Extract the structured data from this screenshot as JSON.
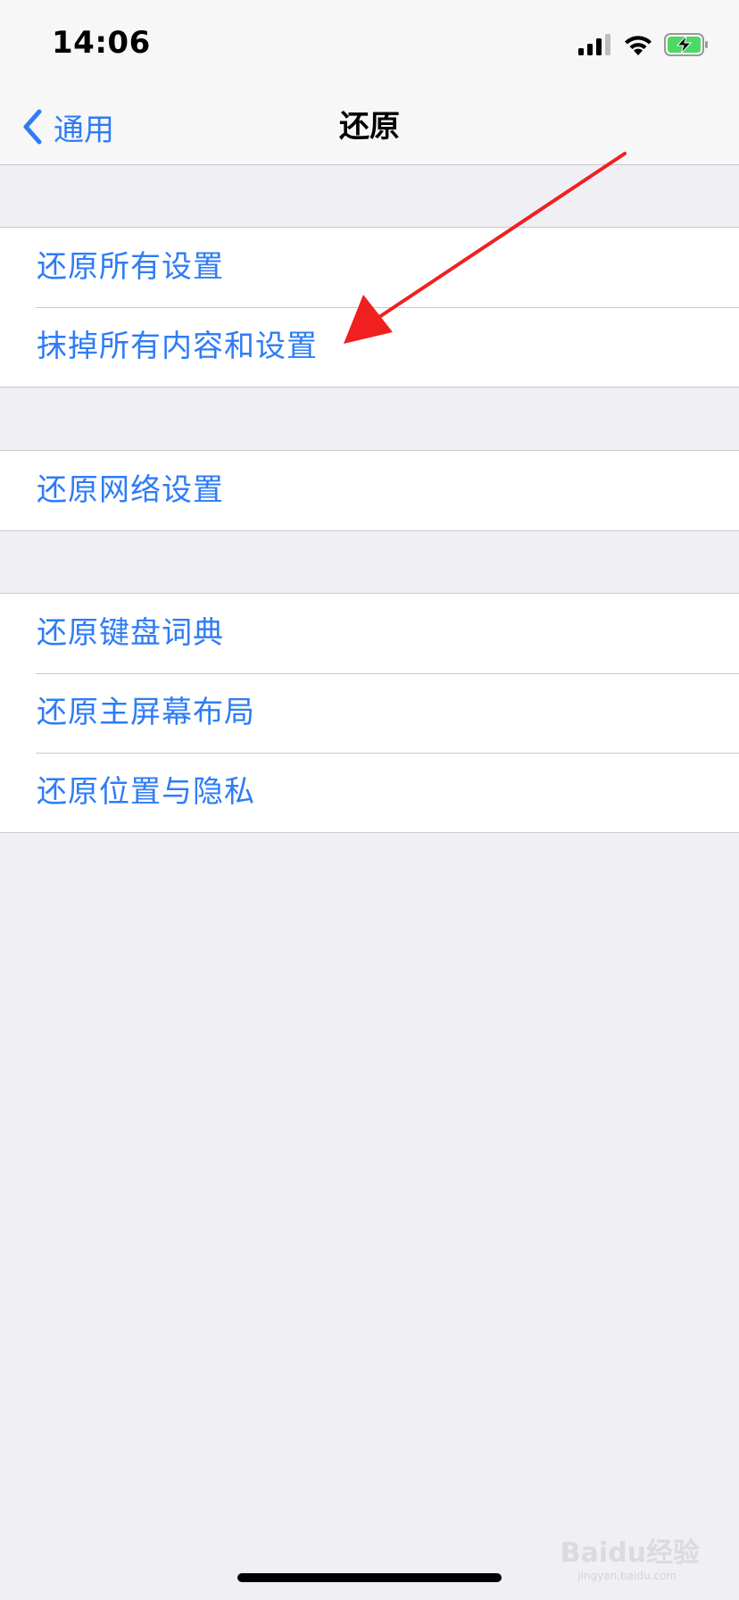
{
  "status_bar": {
    "time": "14:06",
    "icons": [
      "cellular-signal-icon",
      "wifi-icon",
      "battery-charging-icon"
    ]
  },
  "nav": {
    "back_label": "通用",
    "title": "还原"
  },
  "groups": [
    {
      "items": [
        {
          "label": "还原所有设置"
        },
        {
          "label": "抹掉所有内容和设置"
        }
      ]
    },
    {
      "items": [
        {
          "label": "还原网络设置"
        }
      ]
    },
    {
      "items": [
        {
          "label": "还原键盘词典"
        },
        {
          "label": "还原主屏幕布局"
        },
        {
          "label": "还原位置与隐私"
        }
      ]
    }
  ],
  "watermark": {
    "brand": "Baidu经验",
    "url": "jingyan.baidu.com"
  },
  "colors": {
    "accent": "#2e7cf6",
    "background": "#efeff4",
    "annotation_arrow": "#f02020",
    "battery_fill": "#4cd964"
  }
}
